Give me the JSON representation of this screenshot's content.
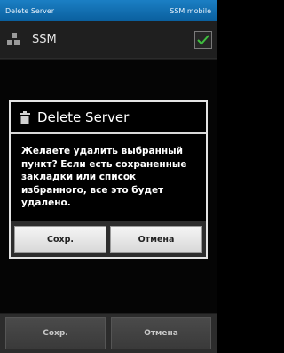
{
  "statusbar": {
    "left_text": "Delete Server",
    "right_text": "SSM mobile"
  },
  "actionbar": {
    "title": "SSM",
    "app_icon": "app-logo-icon",
    "check_icon": "checkmark-icon",
    "check_color": "#3fbf3f"
  },
  "dialog": {
    "title": "Delete Server",
    "icon": "trash-icon",
    "message": "Желаете удалить выбранный пункт? Если есть сохраненные закладки или список избранного, все это будет удалено.",
    "positive_label": "Сохр.",
    "negative_label": "Отмена"
  },
  "bottombar": {
    "save_label": "Сохр.",
    "cancel_label": "Отмена"
  },
  "colors": {
    "statusbar": "#0a5f9e",
    "dialog_border": "#e4e4e4"
  }
}
